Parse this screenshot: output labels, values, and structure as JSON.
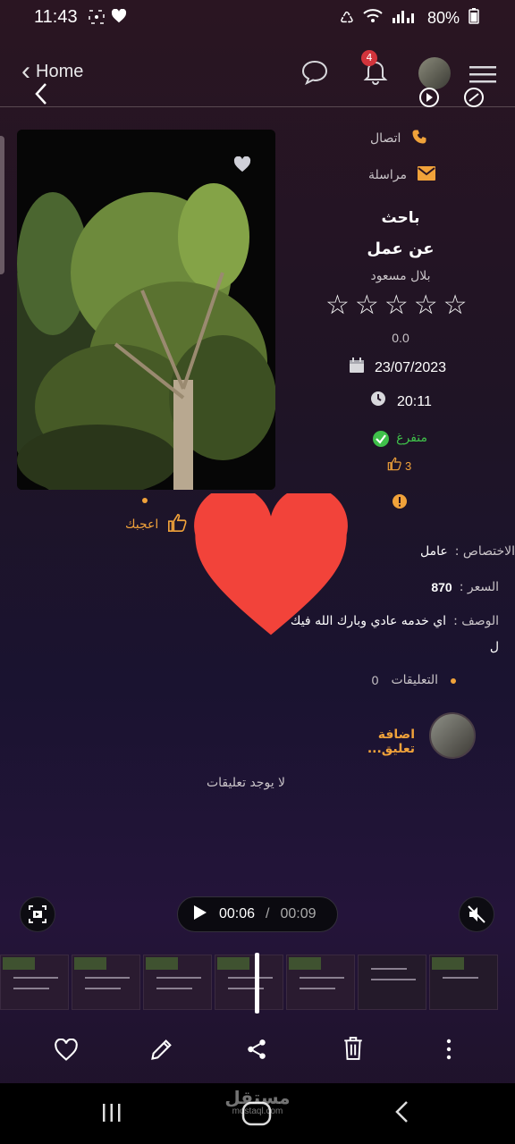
{
  "status": {
    "time": "11:43",
    "battery": "80%"
  },
  "header": {
    "back_label": "Home",
    "notif_count": "4"
  },
  "contact": {
    "call_label": "اتصال",
    "message_label": "مراسلة"
  },
  "job": {
    "title_line1": "باحث",
    "title_line2": "عن عمل",
    "owner": "بلال مسعود",
    "rating": "0.0",
    "date": "23/07/2023",
    "time": "20:11",
    "status": "متفرغ",
    "likes_count": "3",
    "like_label": "اعجبك"
  },
  "details": {
    "specialty_label": "الاختصاص :",
    "specialty_value": "عامل",
    "price_label": "السعر :",
    "price_value": "870",
    "description_label": "الوصف :",
    "description_value": "اي خدمه عادي وبارك الله فيك",
    "description_wrap": "ل",
    "comments_label": "التعليقات",
    "comments_count": "0"
  },
  "comments": {
    "add_placeholder": "اضافة تعليق...",
    "empty_text": "لا يوجد تعليقات"
  },
  "player": {
    "current": "00:06",
    "separator": "/",
    "total": "00:09"
  },
  "watermark": {
    "text": "مستقل",
    "sub": "mostaql.com"
  },
  "colors": {
    "accent": "#f0a23a",
    "heart": "#f2433a",
    "status_green": "#3fc04a",
    "badge": "#d2343c"
  },
  "icons": [
    "chat-bubble-icon",
    "bell-icon",
    "menu-icon",
    "phone-icon",
    "envelope-icon",
    "calendar-icon",
    "clock-icon",
    "check-circle-icon",
    "thumbs-up-icon",
    "warning-icon",
    "heart-icon",
    "pencil-icon",
    "share-icon",
    "trash-icon",
    "more-vertical-icon"
  ]
}
